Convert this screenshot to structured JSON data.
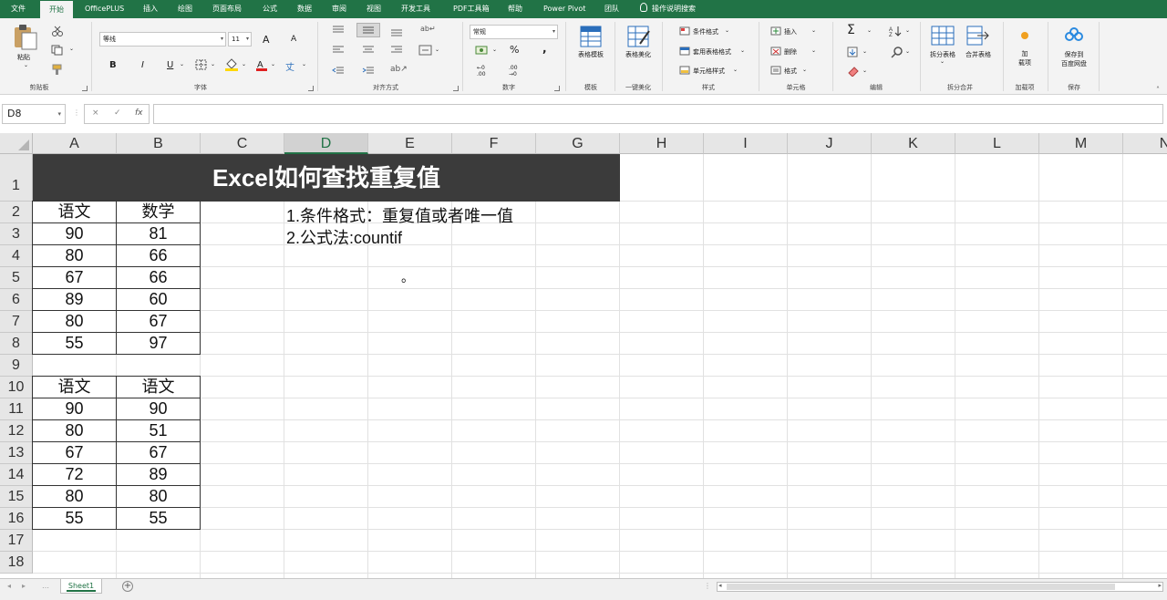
{
  "ribbon_tabs": [
    "文件",
    "开始",
    "OfficePLUS",
    "插入",
    "绘图",
    "页面布局",
    "公式",
    "数据",
    "审阅",
    "视图",
    "开发工具",
    "PDF工具箱",
    "帮助",
    "Power Pivot",
    "团队"
  ],
  "active_tab": "开始",
  "tell_me": "操作说明搜索",
  "clipboard": {
    "paste": "粘贴",
    "label": "剪贴板"
  },
  "font": {
    "name": "等线",
    "size": "11",
    "label": "字体",
    "bold": "B",
    "italic": "I",
    "underline": "U",
    "grow": "A",
    "shrink": "A"
  },
  "alignment": {
    "label": "对齐方式"
  },
  "number": {
    "format": "常规",
    "label": "数字",
    "percent": "%",
    "comma": ","
  },
  "template": {
    "btn": "表格模板",
    "label": "模板"
  },
  "beautify": {
    "btn": "表格美化",
    "label": "一键美化"
  },
  "styles": {
    "conditional": "条件格式",
    "table_format": "套用表格格式",
    "cell_style": "单元格样式",
    "label": "样式"
  },
  "cells": {
    "insert": "插入",
    "delete": "删除",
    "format": "格式",
    "label": "单元格"
  },
  "editing": {
    "label": "编辑",
    "sum": "Σ"
  },
  "split": {
    "split_table": "拆分表格",
    "merge_table": "合并表格",
    "label": "拆分合并"
  },
  "addins": {
    "btn_line1": "加",
    "btn_line2": "载项",
    "label": "加载项"
  },
  "save": {
    "btn_line1": "保存到",
    "btn_line2": "百度网盘",
    "label": "保存"
  },
  "formula_bar": {
    "name_box": "D8",
    "cancel": "×",
    "enter": "✓",
    "fx": "fx",
    "value": ""
  },
  "columns": [
    "A",
    "B",
    "C",
    "D",
    "E",
    "F",
    "G",
    "H",
    "I",
    "J",
    "K",
    "L",
    "M",
    "N"
  ],
  "selected_column": "D",
  "rows": [
    "1",
    "2",
    "3",
    "4",
    "5",
    "6",
    "7",
    "8",
    "9",
    "10",
    "11",
    "12",
    "13",
    "14",
    "15",
    "16",
    "17",
    "18"
  ],
  "sheet": {
    "title": "Excel如何查找重复值",
    "table1": {
      "headers": [
        "语文",
        "数学"
      ],
      "rows": [
        [
          "90",
          "81"
        ],
        [
          "80",
          "66"
        ],
        [
          "67",
          "66"
        ],
        [
          "89",
          "60"
        ],
        [
          "80",
          "67"
        ],
        [
          "55",
          "97"
        ]
      ]
    },
    "table2": {
      "headers": [
        "语文",
        "语文"
      ],
      "rows": [
        [
          "90",
          "90"
        ],
        [
          "80",
          "51"
        ],
        [
          "67",
          "67"
        ],
        [
          "72",
          "89"
        ],
        [
          "80",
          "80"
        ],
        [
          "55",
          "55"
        ]
      ]
    },
    "notes": [
      "1.条件格式：重复值或者唯一值",
      "2.公式法:countif"
    ],
    "marker": "。"
  },
  "sheet_tabs": [
    "Sheet1"
  ],
  "colors": {
    "brand": "#217346",
    "title_bg": "#3b3b3b"
  }
}
